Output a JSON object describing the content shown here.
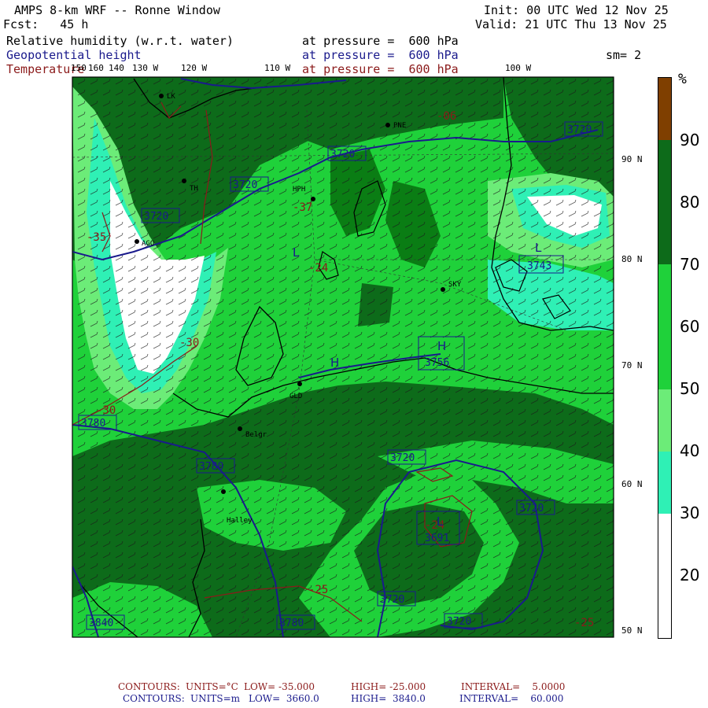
{
  "header": {
    "model": "AMPS 8-km WRF -- Ronne Window",
    "forecast": "Fcst:   45 h",
    "init": "Init: 00 UTC Wed 12 Nov 25",
    "valid": "Valid: 21 UTC Thu 13 Nov 25",
    "field1": "Relative humidity (w.r.t. water)",
    "field2": "Geopotential height",
    "field3": "Temperature",
    "level1": "at pressure =  600 hPa",
    "level2": "at pressure =  600 hPa",
    "level3": "at pressure =  600 hPa",
    "smoothing": "sm= 2"
  },
  "lon_labels": [
    "150",
    "160",
    "140",
    "130 W",
    "120 W",
    "110 W",
    "100 W"
  ],
  "lat_labels": [
    "90 N",
    "80 N",
    "70 N",
    "60 N",
    "50 N"
  ],
  "colorbar": {
    "unit": "%",
    "labels": [
      "90",
      "80",
      "70",
      "60",
      "50",
      "40",
      "30",
      "20"
    ],
    "colors": [
      "#7f3f00",
      "#0d6b1a",
      "#0a7d14",
      "#1fd13a",
      "#6cec78",
      "#2ff0b5",
      "#ffffff"
    ]
  },
  "stations": [
    "LK",
    "PNE",
    "TH",
    "HPH",
    "AGO",
    "SKY",
    "GLD",
    "Belgr",
    "Halley"
  ],
  "height_labels": [
    "3720",
    "3720",
    "3720",
    "3720",
    "3743",
    "3756",
    "3780",
    "3780",
    "3720",
    "3720",
    "3691",
    "3720",
    "3720",
    "3780",
    "3840"
  ],
  "temp_labels": [
    "-37",
    "-24",
    "-35",
    "-30",
    "-30",
    "-25",
    "-25",
    "-06",
    "-24"
  ],
  "pressure_marks": [
    "H",
    "H",
    "L",
    "L",
    "L"
  ],
  "footer": {
    "line1_label": "CONTOURS:",
    "line1_units": "UNITS=°C",
    "line1_low": "LOW= -35.000",
    "line1_high": "HIGH= -25.000",
    "line1_interval": "INTERVAL=    5.0000",
    "line2_label": "CONTOURS:",
    "line2_units": "UNITS=m",
    "line2_low": "LOW=  3660.0",
    "line2_high": "HIGH=  3840.0",
    "line2_interval": "INTERVAL=    60.000"
  }
}
